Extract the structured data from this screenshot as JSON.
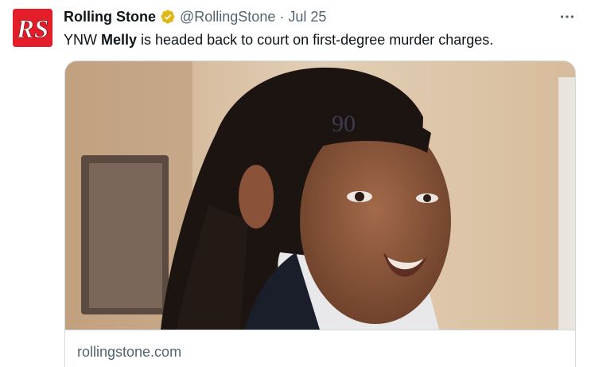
{
  "author": {
    "name": "Rolling Stone",
    "handle": "@RollingStone",
    "separator": "·",
    "date": "Jul 25",
    "avatar_text": "RS",
    "avatar_color": "#e41d2a",
    "verified_icon": "gold-verified-badge",
    "verified_color": "#e2b719"
  },
  "tweet": {
    "text_before": "YNW ",
    "text_bold": "Melly",
    "text_after": " is headed back to court on first-degree murder charges."
  },
  "card": {
    "domain": "rollingstone.com",
    "title": ""
  },
  "icons": {
    "more": "more-horizontal-icon"
  }
}
